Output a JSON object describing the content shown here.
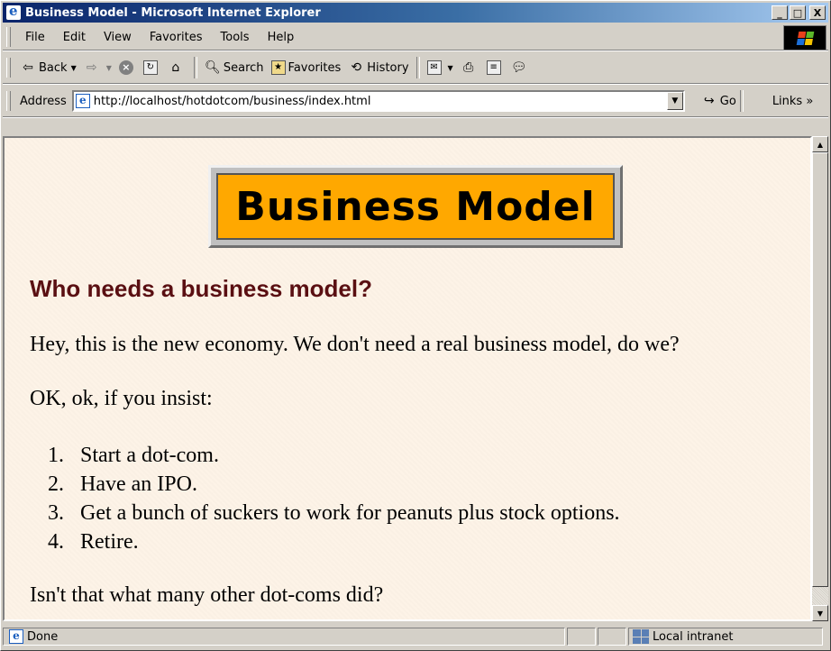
{
  "window": {
    "title": "Business Model - Microsoft Internet Explorer",
    "controls": {
      "minimize": "_",
      "maximize": "□",
      "close": "X"
    }
  },
  "menu": [
    "File",
    "Edit",
    "View",
    "Favorites",
    "Tools",
    "Help"
  ],
  "toolbar": {
    "back_label": "Back",
    "search_label": "Search",
    "favorites_label": "Favorites",
    "history_label": "History"
  },
  "address": {
    "label": "Address",
    "url": "http://localhost/hotdotcom/business/index.html",
    "go_label": "Go",
    "links_label": "Links »"
  },
  "page": {
    "logo_text": "Business Model",
    "heading": "Who needs a business model?",
    "intro": "Hey, this is the new economy. We don't need a real business model, do we?",
    "insist": "OK, ok, if you insist:",
    "steps": [
      {
        "num": "1.",
        "text": "Start a dot-com."
      },
      {
        "num": "2.",
        "text": "Have an IPO."
      },
      {
        "num": "3.",
        "text": "Get a bunch of suckers to work for peanuts plus stock options."
      },
      {
        "num": "4.",
        "text": "Retire."
      }
    ],
    "closing": "Isn't that what many other dot-coms did?"
  },
  "status": {
    "text": "Done",
    "zone": "Local intranet"
  },
  "colors": {
    "page_background": "#fdf3e7",
    "heading": "#5a0f12",
    "logo_background": "#ffa800",
    "titlebar_start": "#0a246a"
  }
}
